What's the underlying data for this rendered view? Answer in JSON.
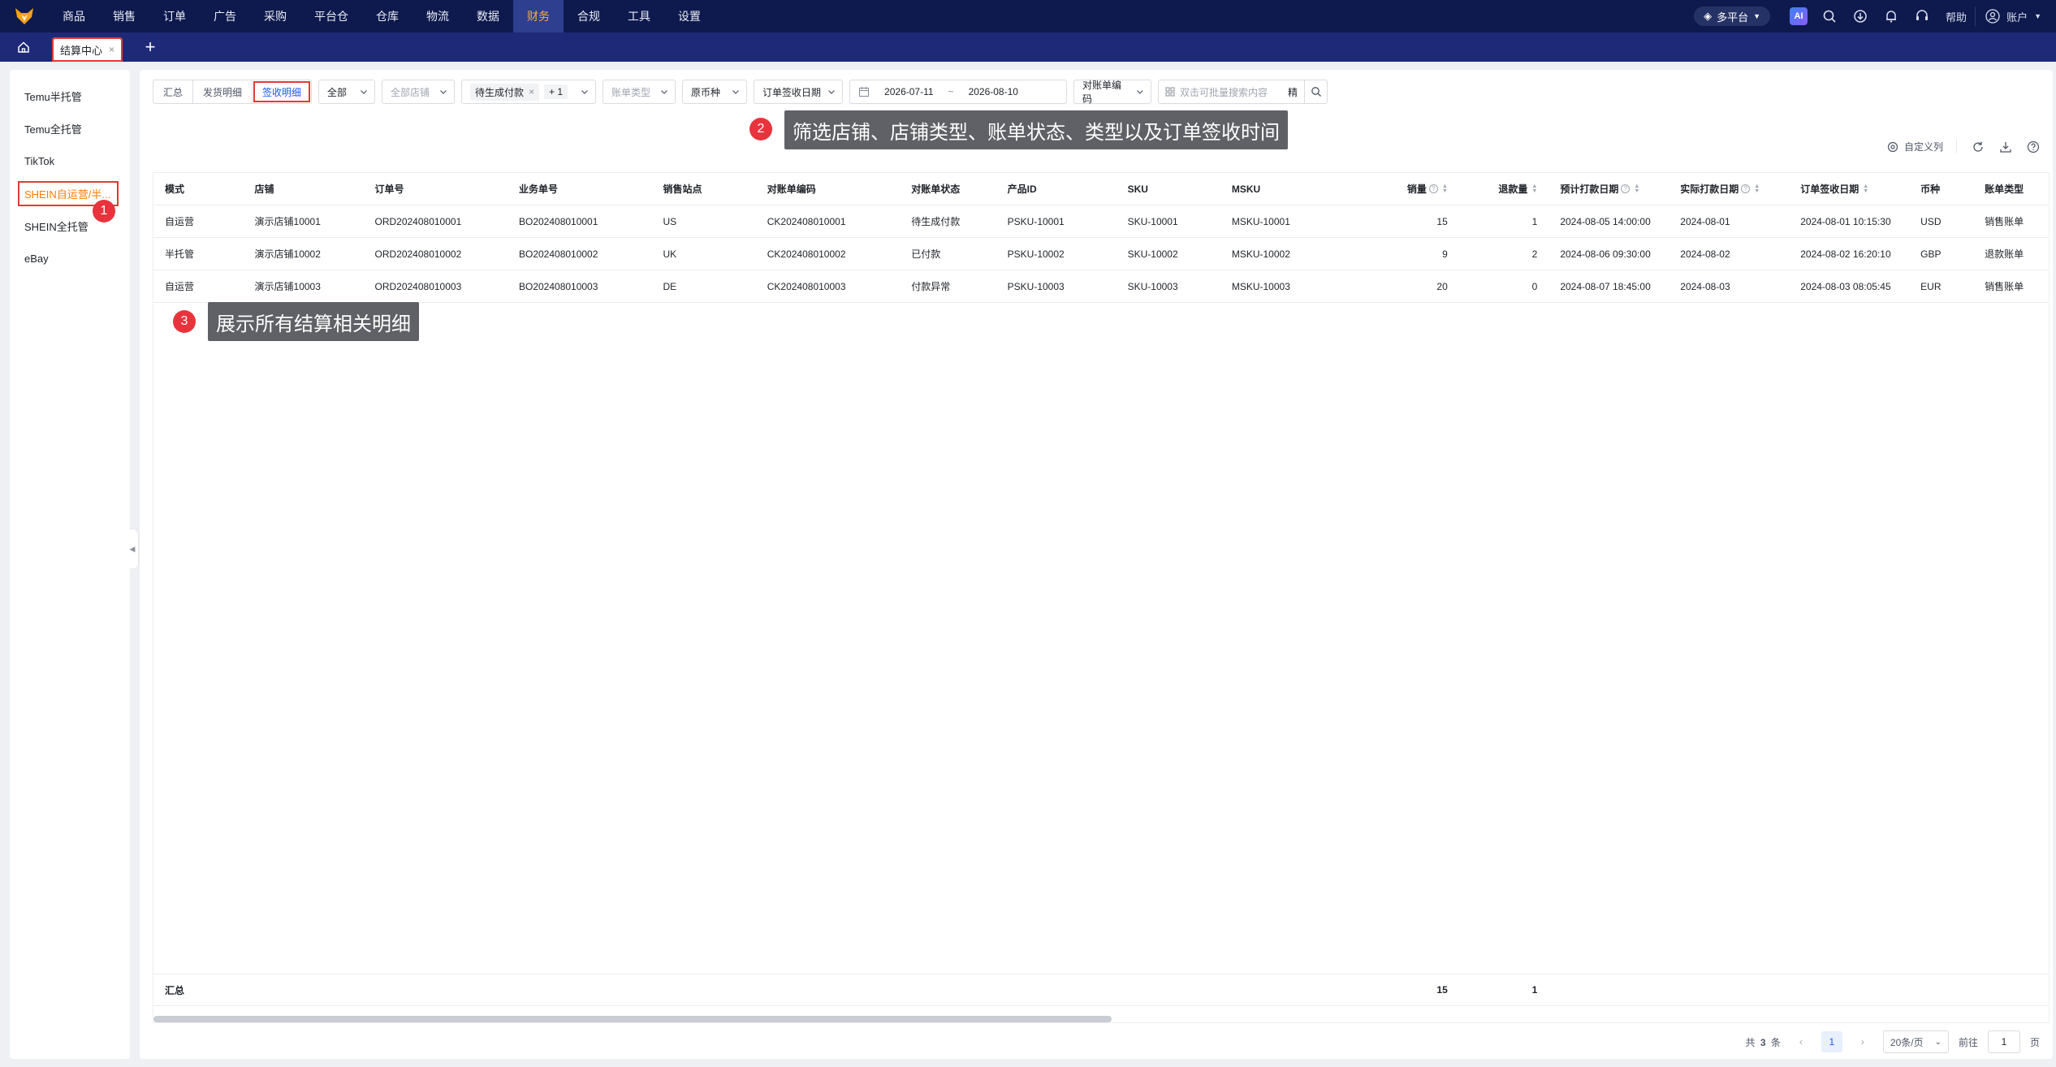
{
  "nav": {
    "items": [
      "商品",
      "销售",
      "订单",
      "广告",
      "采购",
      "平台仓",
      "仓库",
      "物流",
      "数据",
      "财务",
      "合规",
      "工具",
      "设置"
    ],
    "active_index": 9,
    "platform_label": "多平台",
    "help_label": "帮助",
    "account_label": "账户"
  },
  "tabs": {
    "current": "结算中心",
    "close": "×",
    "add": "+"
  },
  "sidebar": {
    "items": [
      "Temu半托管",
      "Temu全托管",
      "TikTok",
      "SHEIN自运营/半...",
      "SHEIN全托管",
      "eBay"
    ],
    "active_index": 3
  },
  "filters": {
    "segments": [
      "汇总",
      "发货明细",
      "签收明细"
    ],
    "active_segment": 2,
    "mode_select": "全部",
    "store_placeholder": "全部店铺",
    "status_tag": "待生成付款",
    "status_more": "+ 1",
    "bill_type_placeholder": "账单类型",
    "currency_select": "原币种",
    "date_type": "订单签收日期",
    "date_start": "2026-07-11",
    "date_sep": "~",
    "date_end": "2026-08-10",
    "code_select": "对账单编码",
    "search_placeholder": "双击可批量搜索内容",
    "precise_label": "精"
  },
  "annotations": {
    "badge1": "1",
    "badge2": "2",
    "badge3": "3",
    "callout2": "筛选店铺、店铺类型、账单状态、类型以及订单签收时间",
    "callout3": "展示所有结算相关明细"
  },
  "toolbar": {
    "custom_columns": "自定义列"
  },
  "table": {
    "headers": [
      "模式",
      "店铺",
      "订单号",
      "业务单号",
      "销售站点",
      "对账单编码",
      "对账单状态",
      "产品ID",
      "SKU",
      "MSKU",
      "销量",
      "退款量",
      "预计打款日期",
      "实际打款日期",
      "订单签收日期",
      "币种",
      "账单类型"
    ],
    "rows": [
      [
        "自运营",
        "演示店铺10001",
        "ORD202408010001",
        "BO202408010001",
        "US",
        "CK202408010001",
        "待生成付款",
        "PSKU-10001",
        "SKU-10001",
        "MSKU-10001",
        "15",
        "1",
        "2024-08-05 14:00:00",
        "2024-08-01",
        "2024-08-01 10:15:30",
        "USD",
        "销售账单"
      ],
      [
        "半托管",
        "演示店铺10002",
        "ORD202408010002",
        "BO202408010002",
        "UK",
        "CK202408010002",
        "已付款",
        "PSKU-10002",
        "SKU-10002",
        "MSKU-10002",
        "9",
        "2",
        "2024-08-06 09:30:00",
        "2024-08-02",
        "2024-08-02 16:20:10",
        "GBP",
        "退款账单"
      ],
      [
        "自运营",
        "演示店铺10003",
        "ORD202408010003",
        "BO202408010003",
        "DE",
        "CK202408010003",
        "付款异常",
        "PSKU-10003",
        "SKU-10003",
        "MSKU-10003",
        "20",
        "0",
        "2024-08-07 18:45:00",
        "2024-08-03",
        "2024-08-03 08:05:45",
        "EUR",
        "销售账单"
      ]
    ],
    "footer_label": "汇总",
    "footer_sales": "15",
    "footer_refund": "1"
  },
  "pager": {
    "total_prefix": "共",
    "total": "3",
    "total_suffix": "条",
    "current_page": "1",
    "page_size": "20条/页",
    "goto_label": "前往",
    "goto_value": "1",
    "page_suffix": "页"
  },
  "colors": {
    "nav_bg": "#0e1a4d",
    "tab_bg": "#1e2a78",
    "active_nav": "#ffa940",
    "accent": "#1a56ff",
    "annotation_red": "#e8333d",
    "highlight_border": "#e53935"
  }
}
